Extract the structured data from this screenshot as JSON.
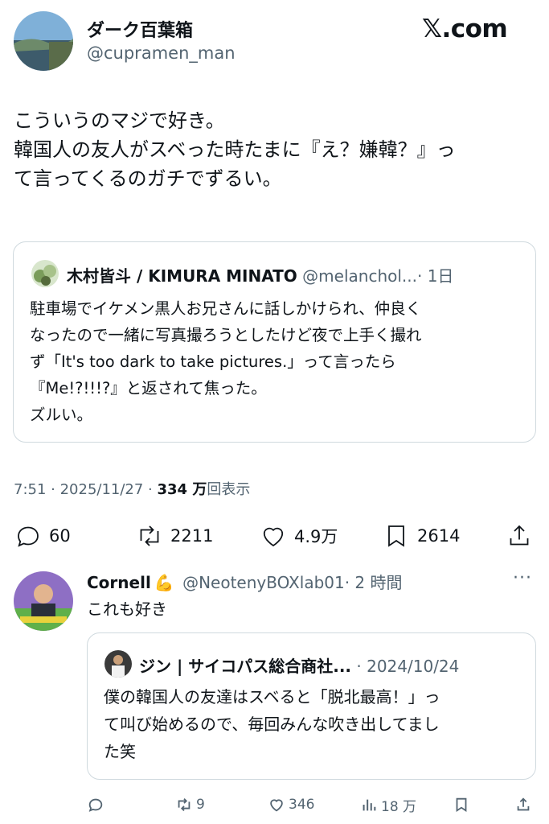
{
  "brand": "𝕏.com",
  "post": {
    "author_name": "ダーク百葉箱",
    "handle": "@cupramen_man",
    "text_lines": [
      "こういうのマジで好き。",
      "韓国人の友人がスベった時たまに『え？嫌韓？』っ",
      "て言ってくるのガチでずるい。"
    ],
    "quote": {
      "author_name": "木村皆斗 / KIMURA MINATO",
      "handle": "@melanchol...",
      "time": "· 1日",
      "text_lines": [
        "駐車場でイケメン黒人お兄さんに話しかけられ、仲良く",
        "なったので一緒に写真撮ろうとしたけど夜で上手く撮れ",
        "ず「It's too dark to take pictures.」って言ったら",
        "『Me!?!!!?』と返されて焦った。",
        "ズルい。"
      ]
    },
    "meta_time": "7:51 · 2025/11/27 · ",
    "views_count": "334 万",
    "views_label": "回表示",
    "actions": {
      "replies": "60",
      "reposts": "2211",
      "likes": "4.9万",
      "bookmarks": "2614"
    }
  },
  "reply": {
    "author_name": "Cornell",
    "emoji": "💪",
    "handle": "@NeotenyBOXlab01",
    "time": "· 2 時間",
    "text": "これも好き",
    "quote": {
      "author_name": "ジン | サイコパス総合商社...",
      "time": "· 2024/10/24",
      "text_lines": [
        "僕の韓国人の友達はスベると「脱北最高！」っ",
        "て叫び始めるので、毎回みんな吹き出してまし",
        "た笑"
      ]
    },
    "actions": {
      "replies": "",
      "reposts": "9",
      "likes": "346",
      "views": "18 万"
    }
  },
  "colors": {
    "text": "#0f1419",
    "muted": "#536471",
    "border": "#cfd9de"
  }
}
